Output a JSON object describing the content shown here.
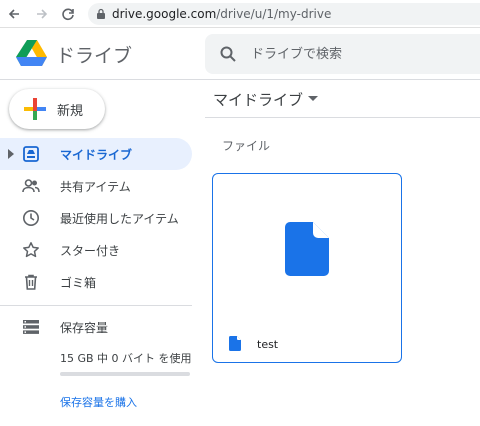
{
  "browser": {
    "url_host": "drive.google.com",
    "url_path": "/drive/u/1/my-drive"
  },
  "header": {
    "app_title": "ドライブ",
    "search_placeholder": "ドライブで検索"
  },
  "sidebar": {
    "new_label": "新規",
    "items": [
      {
        "label": "マイドライブ",
        "icon": "my-drive-icon",
        "active": true
      },
      {
        "label": "共有アイテム",
        "icon": "shared-people-icon",
        "active": false
      },
      {
        "label": "最近使用したアイテム",
        "icon": "clock-icon",
        "active": false
      },
      {
        "label": "スター付き",
        "icon": "star-icon",
        "active": false
      },
      {
        "label": "ゴミ箱",
        "icon": "trash-icon",
        "active": false
      }
    ],
    "storage": {
      "label": "保存容量",
      "usage": "15 GB 中 0 バイト を使用",
      "used_fraction": 0.0,
      "buy_link": "保存容量を購入"
    }
  },
  "main": {
    "title": "マイドライブ",
    "section_label": "ファイル",
    "files": [
      {
        "name": "test",
        "icon": "document-icon"
      }
    ]
  },
  "colors": {
    "accent": "#1a73e8",
    "active_bg": "#e8f0fe",
    "active_text": "#1967d2",
    "search_bg": "#f1f3f4"
  }
}
